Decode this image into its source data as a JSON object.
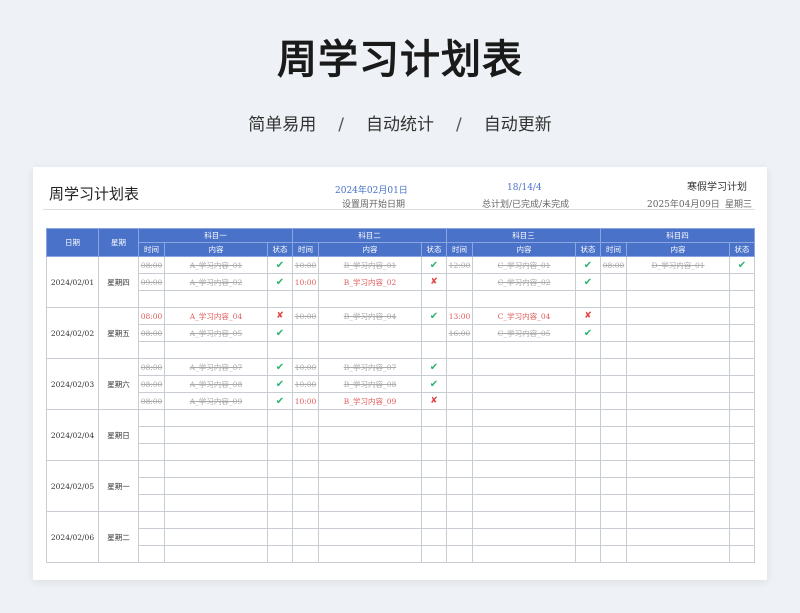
{
  "hero": {
    "title": "周学习计划表",
    "features": [
      "简单易用",
      "自动统计",
      "自动更新"
    ],
    "separator": "/"
  },
  "sheet": {
    "title": "周学习计划表",
    "start_date": "2024年02月01日",
    "start_date_label": "设置周开始日期",
    "stats": "18/14/4",
    "stats_label": "总计划/已完成/未完成",
    "plan_name": "寒假学习计划",
    "today": "2025年04月09日",
    "today_weekday": "星期三"
  },
  "table": {
    "col_date": "日期",
    "col_weekday": "星期",
    "subjects": [
      "科目一",
      "科目二",
      "科目三",
      "科目四"
    ],
    "sub_headers": [
      "时间",
      "内容",
      "状态"
    ],
    "days": [
      {
        "date": "2024/02/01",
        "weekday": "星期四",
        "rows": [
          [
            {
              "t": "08:00",
              "c": "A_学习内容_01",
              "s": "done"
            },
            {
              "t": "10:00",
              "c": "B_学习内容_01",
              "s": "done"
            },
            {
              "t": "12:00",
              "c": "C_学习内容_01",
              "s": "done"
            },
            {
              "t": "08:00",
              "c": "D_学习内容_01",
              "s": "done"
            }
          ],
          [
            {
              "t": "09:00",
              "c": "A_学习内容_02",
              "s": "done"
            },
            {
              "t": "10:00",
              "c": "B_学习内容_02",
              "s": "todo"
            },
            {
              "t": "",
              "c": "C_学习内容_02",
              "s": "done"
            },
            null
          ],
          [
            null,
            null,
            null,
            null
          ]
        ]
      },
      {
        "date": "2024/02/02",
        "weekday": "星期五",
        "rows": [
          [
            {
              "t": "08:00",
              "c": "A_学习内容_04",
              "s": "todo"
            },
            {
              "t": "10:00",
              "c": "B_学习内容_04",
              "s": "done"
            },
            {
              "t": "13:00",
              "c": "C_学习内容_04",
              "s": "todo"
            },
            null
          ],
          [
            {
              "t": "08:00",
              "c": "A_学习内容_05",
              "s": "done"
            },
            null,
            {
              "t": "16:00",
              "c": "C_学习内容_05",
              "s": "done"
            },
            null
          ],
          [
            null,
            null,
            null,
            null
          ]
        ]
      },
      {
        "date": "2024/02/03",
        "weekday": "星期六",
        "rows": [
          [
            {
              "t": "08:00",
              "c": "A_学习内容_07",
              "s": "done"
            },
            {
              "t": "10:00",
              "c": "B_学习内容_07",
              "s": "done"
            },
            null,
            null
          ],
          [
            {
              "t": "08:00",
              "c": "A_学习内容_08",
              "s": "done"
            },
            {
              "t": "10:00",
              "c": "B_学习内容_08",
              "s": "done"
            },
            null,
            null
          ],
          [
            {
              "t": "08:00",
              "c": "A_学习内容_09",
              "s": "done"
            },
            {
              "t": "10:00",
              "c": "B_学习内容_09",
              "s": "todo"
            },
            null,
            null
          ]
        ]
      },
      {
        "date": "2024/02/04",
        "weekday": "星期日",
        "rows": [
          [
            null,
            null,
            null,
            null
          ],
          [
            null,
            null,
            null,
            null
          ],
          [
            null,
            null,
            null,
            null
          ]
        ]
      },
      {
        "date": "2024/02/05",
        "weekday": "星期一",
        "rows": [
          [
            null,
            null,
            null,
            null
          ],
          [
            null,
            null,
            null,
            null
          ],
          [
            null,
            null,
            null,
            null
          ]
        ]
      },
      {
        "date": "2024/02/06",
        "weekday": "星期二",
        "rows": [
          [
            null,
            null,
            null,
            null
          ],
          [
            null,
            null,
            null,
            null
          ],
          [
            null,
            null,
            null,
            null
          ]
        ]
      }
    ],
    "check_symbol": "✔",
    "cross_symbol": "✘",
    "colors": {
      "header": "#4a72c9",
      "ok": "#2bb673",
      "todo": "#e25b5b"
    }
  }
}
